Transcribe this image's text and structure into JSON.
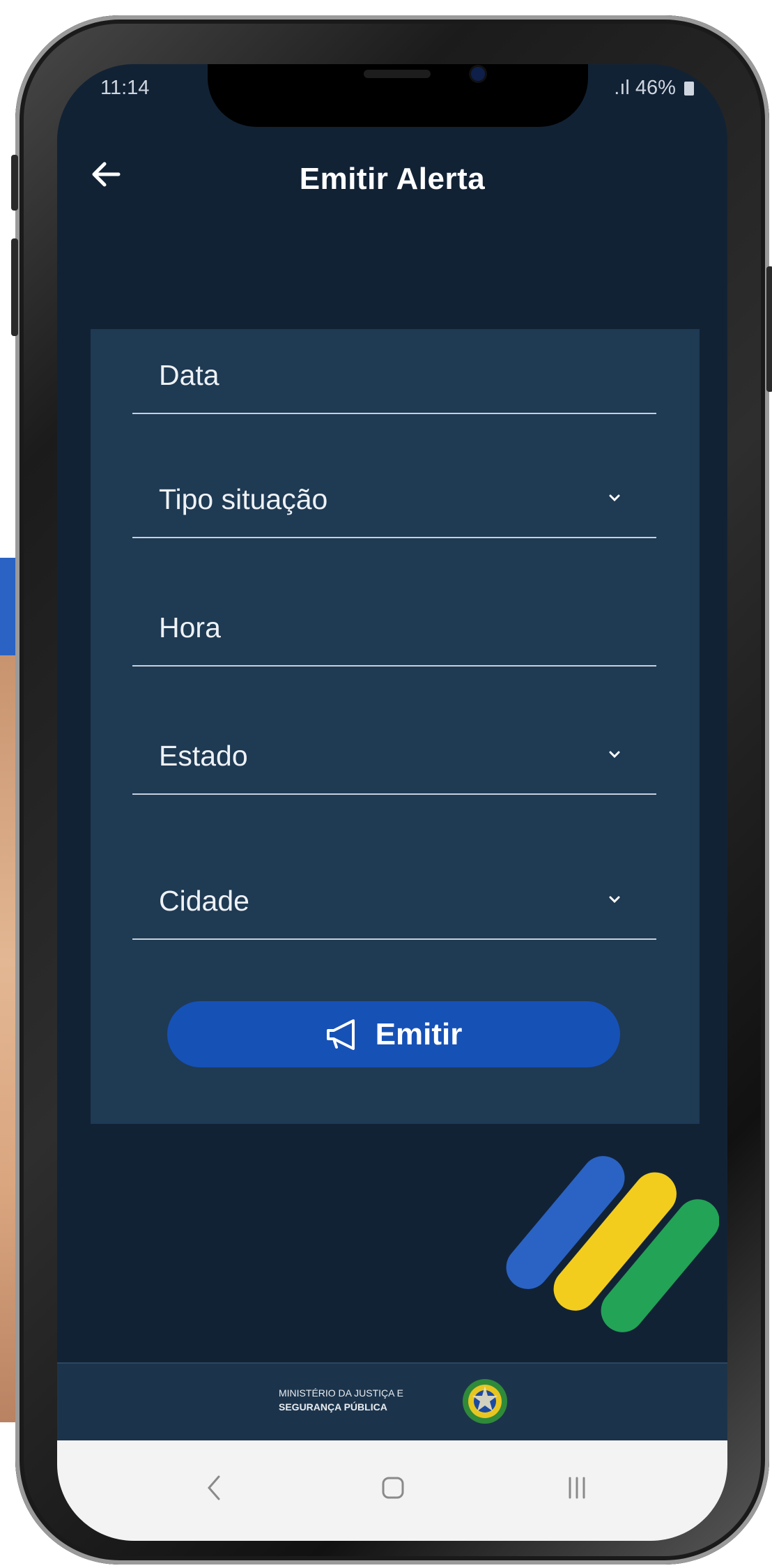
{
  "status_bar": {
    "time": "11:14",
    "battery": "46%"
  },
  "app_bar": {
    "title": "Emitir Alerta",
    "back_icon": "arrow-left-icon"
  },
  "form": {
    "fields": [
      {
        "label": "Data",
        "type": "text"
      },
      {
        "label": "Tipo situação",
        "type": "select"
      },
      {
        "label": "Hora",
        "type": "text"
      },
      {
        "label": "Estado",
        "type": "select"
      },
      {
        "label": "Cidade",
        "type": "select"
      }
    ],
    "submit_label": "Emitir",
    "submit_icon": "megaphone-icon"
  },
  "footer": {
    "line1": "MINISTÉRIO DA JUSTIÇA E",
    "line2": "SEGURANÇA PÚBLICA"
  },
  "colors": {
    "background": "#122235",
    "card": "#1f3a53",
    "accent": "#1651b6",
    "flag_blue": "#2a63c4",
    "flag_yellow": "#f2cd1d",
    "flag_green": "#23a356"
  },
  "navigation": {
    "back": "nav-back-icon",
    "home": "nav-home-icon",
    "recents": "nav-recents-icon"
  }
}
